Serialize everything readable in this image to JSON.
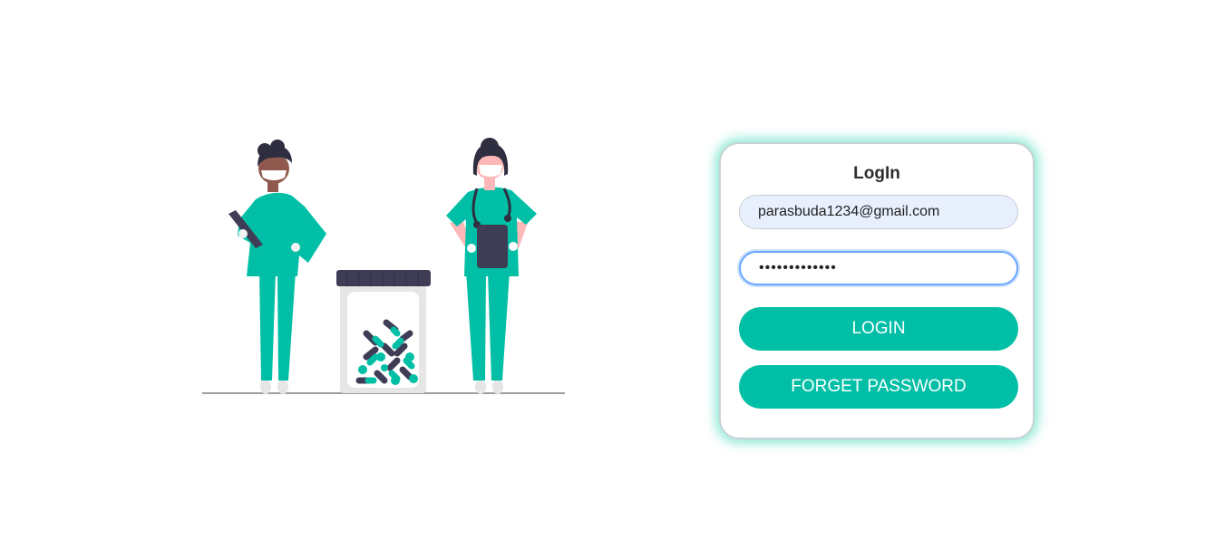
{
  "login_card": {
    "title": "LogIn",
    "email_value": "parasbuda1234@gmail.com",
    "password_value": "paraspassword",
    "login_label": "LOGIN",
    "forget_label": "FORGET PASSWORD"
  },
  "colors": {
    "accent": "#00bfa6",
    "dark": "#3f3d56",
    "email_field_bg": "#e8f0fe",
    "card_glow": "#2cd6b3"
  },
  "illustration": {
    "icon": "medical-staff-illustration"
  }
}
